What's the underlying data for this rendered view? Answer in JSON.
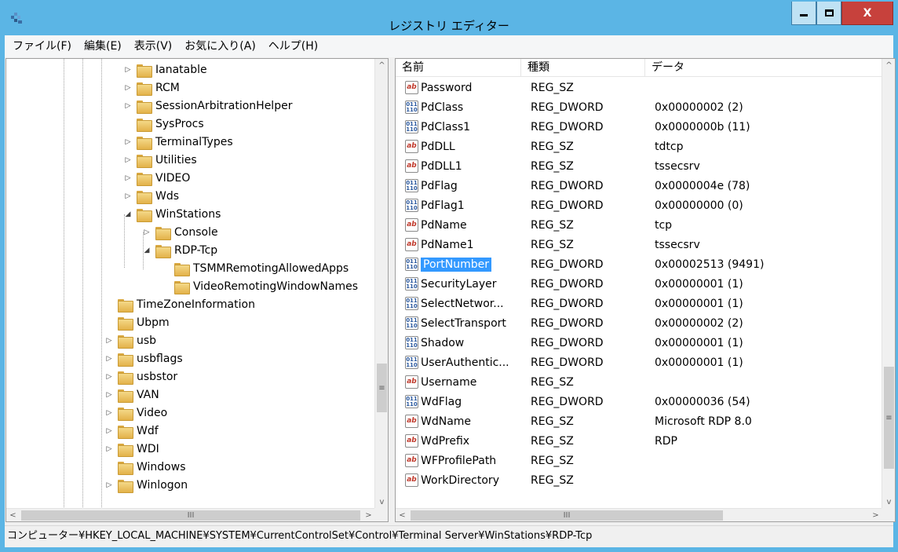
{
  "window": {
    "title": "レジストリ エディター",
    "buttons": {
      "minimize": "▬",
      "maximize": "❐",
      "close": "X"
    }
  },
  "menu": [
    "ファイル(F)",
    "編集(E)",
    "表示(V)",
    "お気に入り(A)",
    "ヘルプ(H)"
  ],
  "tree": [
    {
      "label": "Ianatable",
      "expander": "▷"
    },
    {
      "label": "RCM",
      "expander": "▷"
    },
    {
      "label": "SessionArbitrationHelper",
      "expander": "▷"
    },
    {
      "label": "SysProcs",
      "expander": ""
    },
    {
      "label": "TerminalTypes",
      "expander": "▷"
    },
    {
      "label": "Utilities",
      "expander": "▷"
    },
    {
      "label": "VIDEO",
      "expander": "▷"
    },
    {
      "label": "Wds",
      "expander": "▷"
    },
    {
      "label": "WinStations",
      "expander": "◢"
    },
    {
      "label": "Console",
      "expander": "▷"
    },
    {
      "label": "RDP-Tcp",
      "expander": "◢"
    },
    {
      "label": "TSMMRemotingAllowedApps",
      "expander": ""
    },
    {
      "label": "VideoRemotingWindowNames",
      "expander": ""
    },
    {
      "label": "TimeZoneInformation",
      "expander": ""
    },
    {
      "label": "Ubpm",
      "expander": ""
    },
    {
      "label": "usb",
      "expander": "▷"
    },
    {
      "label": "usbflags",
      "expander": "▷"
    },
    {
      "label": "usbstor",
      "expander": "▷"
    },
    {
      "label": "VAN",
      "expander": "▷"
    },
    {
      "label": "Video",
      "expander": "▷"
    },
    {
      "label": "Wdf",
      "expander": "▷"
    },
    {
      "label": "WDI",
      "expander": "▷"
    },
    {
      "label": "Windows",
      "expander": ""
    },
    {
      "label": "Winlogon",
      "expander": "▷"
    }
  ],
  "list": {
    "columns": [
      "名前",
      "種類",
      "データ"
    ],
    "rows": [
      {
        "icon": "ab",
        "name": "Password",
        "type": "REG_SZ",
        "data": ""
      },
      {
        "icon": "dw",
        "name": "PdClass",
        "type": "REG_DWORD",
        "data": "0x00000002 (2)"
      },
      {
        "icon": "dw",
        "name": "PdClass1",
        "type": "REG_DWORD",
        "data": "0x0000000b (11)"
      },
      {
        "icon": "ab",
        "name": "PdDLL",
        "type": "REG_SZ",
        "data": "tdtcp"
      },
      {
        "icon": "ab",
        "name": "PdDLL1",
        "type": "REG_SZ",
        "data": "tssecsrv"
      },
      {
        "icon": "dw",
        "name": "PdFlag",
        "type": "REG_DWORD",
        "data": "0x0000004e (78)"
      },
      {
        "icon": "dw",
        "name": "PdFlag1",
        "type": "REG_DWORD",
        "data": "0x00000000 (0)"
      },
      {
        "icon": "ab",
        "name": "PdName",
        "type": "REG_SZ",
        "data": "tcp"
      },
      {
        "icon": "ab",
        "name": "PdName1",
        "type": "REG_SZ",
        "data": "tssecsrv"
      },
      {
        "icon": "dw",
        "name": "PortNumber",
        "type": "REG_DWORD",
        "data": "0x00002513 (9491)",
        "selected": true
      },
      {
        "icon": "dw",
        "name": "SecurityLayer",
        "type": "REG_DWORD",
        "data": "0x00000001 (1)"
      },
      {
        "icon": "dw",
        "name": "SelectNetwor...",
        "type": "REG_DWORD",
        "data": "0x00000001 (1)"
      },
      {
        "icon": "dw",
        "name": "SelectTransport",
        "type": "REG_DWORD",
        "data": "0x00000002 (2)"
      },
      {
        "icon": "dw",
        "name": "Shadow",
        "type": "REG_DWORD",
        "data": "0x00000001 (1)"
      },
      {
        "icon": "dw",
        "name": "UserAuthentic...",
        "type": "REG_DWORD",
        "data": "0x00000001 (1)"
      },
      {
        "icon": "ab",
        "name": "Username",
        "type": "REG_SZ",
        "data": ""
      },
      {
        "icon": "dw",
        "name": "WdFlag",
        "type": "REG_DWORD",
        "data": "0x00000036 (54)"
      },
      {
        "icon": "ab",
        "name": "WdName",
        "type": "REG_SZ",
        "data": "Microsoft RDP 8.0"
      },
      {
        "icon": "ab",
        "name": "WdPrefix",
        "type": "REG_SZ",
        "data": "RDP"
      },
      {
        "icon": "ab",
        "name": "WFProfilePath",
        "type": "REG_SZ",
        "data": ""
      },
      {
        "icon": "ab",
        "name": "WorkDirectory",
        "type": "REG_SZ",
        "data": ""
      }
    ],
    "icon_text": {
      "ab": "ab",
      "dw_top": "011",
      "dw_bottom": "110"
    }
  },
  "scroll": {
    "up": "^",
    "down": "v",
    "left": "<",
    "right": ">",
    "grip_v": "≡",
    "grip_h": "III"
  },
  "status": "コンピューター¥HKEY_LOCAL_MACHINE¥SYSTEM¥CurrentControlSet¥Control¥Terminal Server¥WinStations¥RDP-Tcp",
  "colors": {
    "titlebar": "#5bb5e5",
    "selection": "#3399ff",
    "close": "#c7413c"
  }
}
